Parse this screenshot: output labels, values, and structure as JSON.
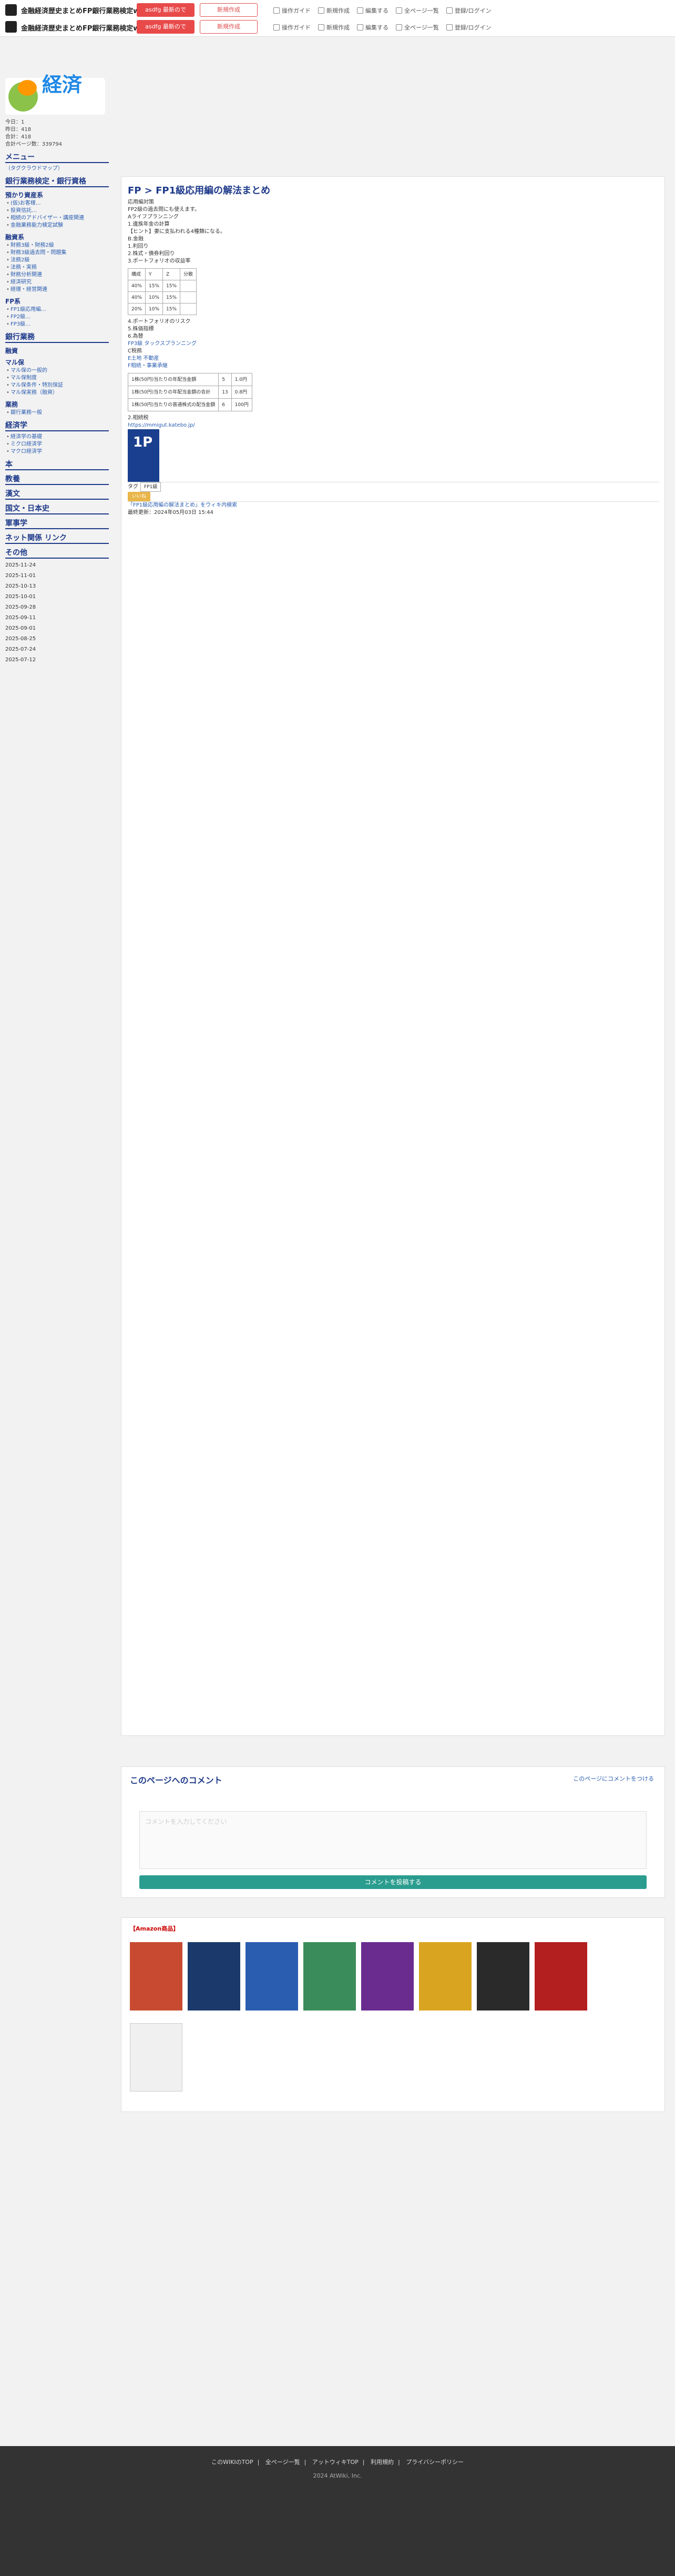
{
  "header": {
    "site_title_1": "金融経済歴史まとめFP銀行業務検定wiki",
    "site_title_2": "金融経済歴史まとめFP銀行業務検定wiki",
    "ad_btn_1": "asdfg 最新ので",
    "ad_btn_2": "新規作成",
    "ad_btn_3": "asdfg 最新ので",
    "ad_btn_4": "新規作成",
    "nav": [
      "操作ガイド",
      "新規作成",
      "編集する",
      "全ページ一覧",
      "登録/ログイン"
    ]
  },
  "sidebar": {
    "logo": "経済",
    "stats": [
      "今日：1",
      "昨日：418",
      "合計：418",
      "合計ページ数：339794"
    ],
    "menu_title": "メニュー",
    "menu_note": "（タグクラウドマップ）",
    "h_ginkou": "銀行業務検定・銀行資格",
    "h_azukari": "預かり資産系",
    "azukari": [
      "(仮)お客様…",
      "投資信託…",
      "相続のアドバイザー・講座関連",
      "金融業務能力検定試験 "
    ],
    "h_yuushi": "融資系",
    "yuushi": [
      "財務3級・財務2級",
      "財務3級過去問・問題集",
      "法務2級",
      "法務・実務",
      "財務分析関連",
      "経済研究",
      "経理・経営関連"
    ],
    "h_fp": "FP系",
    "fp": [
      "FP1級応用編…",
      "FP2級…",
      "FP3級…"
    ],
    "h_ginkou2": "銀行業務",
    "h_yuushi2": "融資",
    "h_mapu": "マル保",
    "mapu": [
      "マル保の一般的",
      "マル保制度",
      "マル保条件・特別保証",
      "マル保実務（融資）"
    ],
    "h_gyoumu": "業務",
    "gyoumu": [
      "銀行業務一般"
    ],
    "h_keizai": "経済学",
    "keizai": [
      "経済学の基礎",
      "ミクロ経済学",
      "マクロ経済学"
    ],
    "h_hon": "本",
    "h_kyouyou": "教養",
    "h_kanbun": "漢文",
    "h_kokugo": "国文・日本史",
    "h_gunjigaku": "軍事学",
    "h_net": "ネット関係 リンク",
    "h_sonota": "その他",
    "dates": [
      "2025-11-24",
      "2025-11-01",
      "2025-10-13",
      "2025-10-01",
      "2025-09-28",
      "2025-09-11",
      "2025-09-01",
      "2025-08-25",
      "2025-07-24",
      "2025-07-12"
    ]
  },
  "main": {
    "breadcrumb": "FP > FP1級応用編の解法まとめ",
    "lines": [
      "応用編対策",
      "FP2級の過去問にも使えます。",
      "Aライフプランニング",
      "1.遺族年金の計算",
      "【ヒント】妻に支払われる4種類になる。",
      "B.金融",
      "1.利回り",
      "2.株式・債券利回り",
      "3.ポートフォリオの収益率",
      "4.ポートフォリオのリスク",
      "5.株価指標",
      "6.為替"
    ],
    "table1_header": [
      "構成",
      "Y",
      "Z",
      "分散"
    ],
    "table1_rows": [
      [
        "40%",
        "15%",
        "15%"
      ],
      [
        "40%",
        "10%",
        "15%"
      ],
      [
        "20%",
        "10%",
        "15%"
      ]
    ],
    "table2_rows": [
      [
        "1株(50円)当たりの年配当金額",
        "5",
        "1.0円"
      ],
      [
        "1株(50円)当たりの年配当金額の合計",
        "13",
        "0.8円"
      ],
      [
        "1株(50円)当たりの普通株式の配当金額",
        "6",
        "100円"
      ]
    ],
    "section_fp": "FP3級 タックスプランニング",
    "section_tax": "C税務",
    "section_fudo": "E土地 不動産",
    "section_souzoku": "F相続・事業承継",
    "section_final": "2.相続税",
    "link_amazon": "https://mmigut.katebo.jp/",
    "tag_label": "タグ",
    "tag_value": "FP1級",
    "like": "いいね",
    "bottom_link": "「FP1級応用編の解法まとめ」をウィキ内検索",
    "bottom_date": "最終更新：2024年05月03日 15:44"
  },
  "comment": {
    "title": "このページへのコメント",
    "placeholder": "コメントを入力してください",
    "button": "コメントを投稿する",
    "link": "このページにコメントをつける"
  },
  "amazon": {
    "title": "【Amazon商品】"
  },
  "footer": {
    "nav": [
      "このWIKIのTOP",
      "全ページ一覧",
      "アットウィキTOP",
      "利用規約",
      "プライバシーポリシー"
    ],
    "copy": "2024 AtWiki, Inc."
  }
}
